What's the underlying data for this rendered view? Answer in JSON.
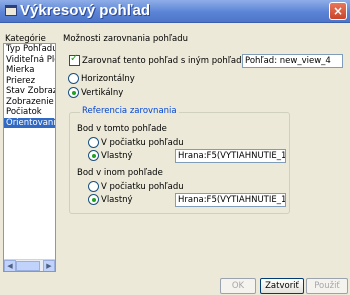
{
  "window": {
    "title": "Výkresový pohľad"
  },
  "categories": {
    "label": "Kategórie",
    "items": [
      "Typ Pohľadu",
      "Viditeľná Plocha",
      "Mierka",
      "Prierez",
      "Stav Zobrazenia",
      "Zobrazenie Pohľadu",
      "Počiatok",
      "Orientovanie"
    ],
    "selected_index": 7
  },
  "main": {
    "section_title": "Možnosti zarovnania pohľadu",
    "align_checkbox_label": "Zarovnať tento pohľad s iným pohľadom",
    "align_target_value": "Pohľad: new_view_4",
    "horizontal_label": "Horizontálny",
    "vertical_label": "Vertikálny",
    "orientation_selected": "vertical",
    "reference": {
      "title": "Referencia zarovnania",
      "this_view_label": "Bod v tomto pohľade",
      "other_view_label": "Bod v inom pohľade",
      "origin_label": "V počiatku pohľadu",
      "custom_label": "Vlastný",
      "this_view_value": "Hrana:F5(VYTIAHNUTIE_1",
      "other_view_value": "Hrana:F5(VYTIAHNUTIE_1"
    }
  },
  "buttons": {
    "ok": "OK",
    "close": "Zatvoriť",
    "apply": "Použiť"
  },
  "icons": {
    "close": "×",
    "scroll_left": "◀",
    "scroll_right": "▶"
  }
}
